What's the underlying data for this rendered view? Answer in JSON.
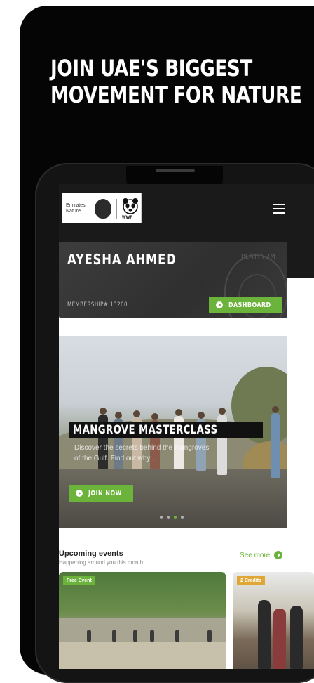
{
  "promo": {
    "headline_line1": "JOIN UAE'S BIGGEST",
    "headline_line2": "MOVEMENT FOR NATURE"
  },
  "header": {
    "logo_text_line1": "Emirates",
    "logo_text_line2": "Nature",
    "logo_partner": "WWF",
    "menu_icon": "hamburger-menu-icon"
  },
  "member_card": {
    "name": "AYESHA AHMED",
    "tier": "PLATINUM",
    "membership": "MEMBERSHIP# 13200",
    "dashboard_label": "DASHBOARD"
  },
  "hero": {
    "title": "MANGROVE MASTERCLASS",
    "description": "Discover the secrets behind the mangroves of the Gulf. Find out why...",
    "join_label": "JOIN NOW",
    "slide_count": 4,
    "active_slide": 3
  },
  "events": {
    "title": "Upcoming events",
    "subtitle": "Happening around you this month",
    "see_more": "See more",
    "cards": [
      {
        "badge": "Free Event",
        "badge_color": "#6bb33a"
      },
      {
        "badge": "2 Credits",
        "badge_color": "#e0a636"
      }
    ]
  },
  "colors": {
    "accent": "#6bb33a",
    "dark": "#1a1a1a"
  }
}
